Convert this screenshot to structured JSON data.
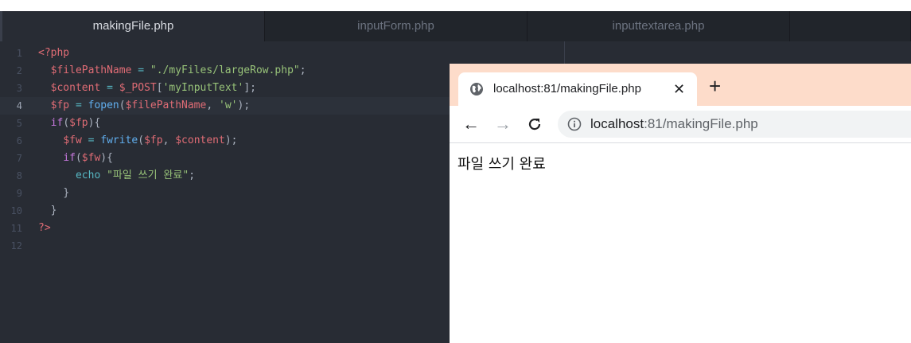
{
  "editor": {
    "tabs": [
      {
        "label": "makingFile.php",
        "active": true
      },
      {
        "label": "inputForm.php",
        "active": false
      },
      {
        "label": "inputtextarea.php",
        "active": false
      }
    ],
    "line_numbers": [
      "1",
      "2",
      "3",
      "4",
      "5",
      "6",
      "7",
      "8",
      "9",
      "10",
      "11",
      "12"
    ],
    "current_line": "4",
    "code": {
      "l1": {
        "open_tag": "<?php"
      },
      "l2": {
        "var": "$filePathName",
        "op": " = ",
        "str": "\"./myFiles/largeRow.php\"",
        "end": ";"
      },
      "l3": {
        "var": "$content",
        "op": " = ",
        "super": "$_POST",
        "br_open": "[",
        "key": "'myInputText'",
        "br_close": "]",
        "end": ";"
      },
      "l4": {
        "var": "$fp",
        "op": " = ",
        "func": "fopen",
        "paren_open": "(",
        "arg1": "$filePathName",
        "comma": ", ",
        "arg2": "'w'",
        "paren_close": ")",
        "end": ";"
      },
      "l5": {
        "kw": "if",
        "paren_open": "(",
        "var": "$fp",
        "close": "){"
      },
      "l6": {
        "var": "$fw",
        "op": " = ",
        "func": "fwrite",
        "paren_open": "(",
        "arg1": "$fp",
        "comma": ", ",
        "arg2": "$content",
        "close": ");"
      },
      "l7": {
        "kw": "if",
        "paren_open": "(",
        "var": "$fw",
        "close": "){"
      },
      "l8": {
        "kw": "echo",
        "str": "\"파일 쓰기 완료\"",
        "end": ";"
      },
      "l9": {
        "brace": "}"
      },
      "l10": {
        "brace": "}"
      },
      "l11": {
        "close_tag": "?>"
      }
    }
  },
  "browser": {
    "tab_title": "localhost:81/makingFile.php",
    "close_glyph": "✕",
    "new_tab_glyph": "+",
    "back_glyph": "←",
    "forward_glyph": "→",
    "reload_glyph": "C",
    "url_host": "localhost",
    "url_rest": ":81/makingFile.php",
    "page_text": "파일 쓰기 완료",
    "icons": {
      "tab": "globe-icon",
      "omnibox": "info-icon"
    }
  },
  "colors": {
    "editor_bg": "#282c34",
    "tabbar_bg": "#21252b",
    "browser_tabstrip": "#fddcca",
    "keyword": "#c678dd",
    "variable": "#e06c75",
    "string": "#98c379",
    "function": "#61afef"
  }
}
